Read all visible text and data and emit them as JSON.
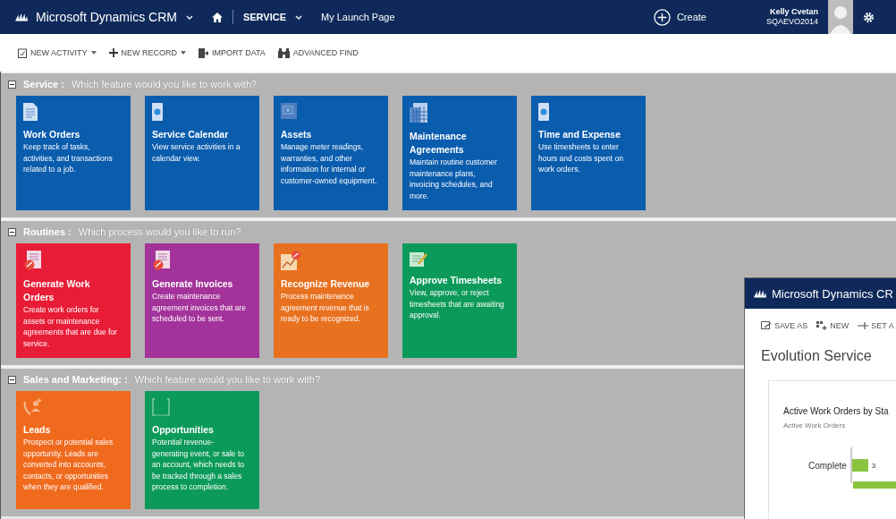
{
  "nav": {
    "app": "Microsoft Dynamics CRM",
    "area": "SERVICE",
    "page": "My Launch Page",
    "create": "Create",
    "user_name": "Kelly Cvetan",
    "user_org": "SQAEVO2014"
  },
  "toolbar": [
    {
      "label": "NEW ACTIVITY",
      "kind": "activity",
      "dropdown": true
    },
    {
      "label": "NEW RECORD",
      "kind": "plus",
      "dropdown": true
    },
    {
      "label": "IMPORT DATA",
      "kind": "import",
      "dropdown": false
    },
    {
      "label": "ADVANCED FIND",
      "kind": "find",
      "dropdown": false
    }
  ],
  "sections": [
    {
      "title": "Service :",
      "prompt": "Which feature would you like to work with?",
      "expanded": true,
      "tiles": [
        {
          "title": "Work Orders",
          "description": "Keep track of tasks, activities, and transactions related to a job.",
          "color": "#0a5cad",
          "kind": "document"
        },
        {
          "title": "Service Calendar",
          "description": "View service activities in a calendar view.",
          "color": "#0a5cad",
          "kind": "calendar"
        },
        {
          "title": "Assets",
          "description": "Manage meter readings, warranties, and other information for internal or customer-owned equipment.",
          "color": "#0a5cad",
          "kind": "asset"
        },
        {
          "title": "Maintenance Agreements",
          "description": "Maintain routine customer maintenance plans, invoicing schedules, and more.",
          "color": "#0a5cad",
          "kind": "agreement"
        },
        {
          "title": "Time and Expense",
          "description": "Use timesheets to enter hours and costs spent on work orders.",
          "color": "#0a5cad",
          "kind": "calendar"
        }
      ]
    },
    {
      "title": "Routines :",
      "prompt": "Which process would you like to run?",
      "expanded": true,
      "tiles": [
        {
          "title": "Generate Work Orders",
          "description": "Create work orders for assets or maintenance agreements that are due for service.",
          "color": "#e81c36",
          "kind": "generate"
        },
        {
          "title": "Generate Invoices",
          "description": "Create maintenance agreement invoices that are scheduled to be sent.",
          "color": "#a3339a",
          "kind": "generate"
        },
        {
          "title": "Recognize Revenue",
          "description": "Process maintenance agreement revenue that is ready to be recognized.",
          "color": "#e8711f",
          "kind": "revenue"
        },
        {
          "title": "Approve Timesheets",
          "description": "View, approve, or reject timesheets that are awaiting approval.",
          "color": "#0c9a5a",
          "kind": "approve"
        }
      ]
    },
    {
      "title": "Sales and Marketing: :",
      "prompt": "Which feature would you like to work with?",
      "expanded": true,
      "tiles": [
        {
          "title": "Leads",
          "description": "Prospect or potential sales opportunity. Leads are converted into accounts, contacts, or opportunities when they are qualified.",
          "color": "#f06a1e",
          "kind": "lead"
        },
        {
          "title": "Opportunities",
          "description": "Potential revenue-generating event, or sale to an account, which needs to be tracked through a sales process to completion.",
          "color": "#0c9a5a",
          "kind": "opportunity"
        }
      ]
    }
  ],
  "overlay": {
    "app": "Microsoft Dynamics CR",
    "commands": [
      {
        "label": "SAVE AS",
        "kind": "save"
      },
      {
        "label": "NEW",
        "kind": "new"
      },
      {
        "label": "SET A",
        "kind": "set"
      }
    ],
    "heading": "Evolution Service",
    "chart_title": "Active Work Orders by Sta",
    "chart_subtitle": "Active Work Orders",
    "bar_label": "Complete",
    "bar_value": "3"
  }
}
